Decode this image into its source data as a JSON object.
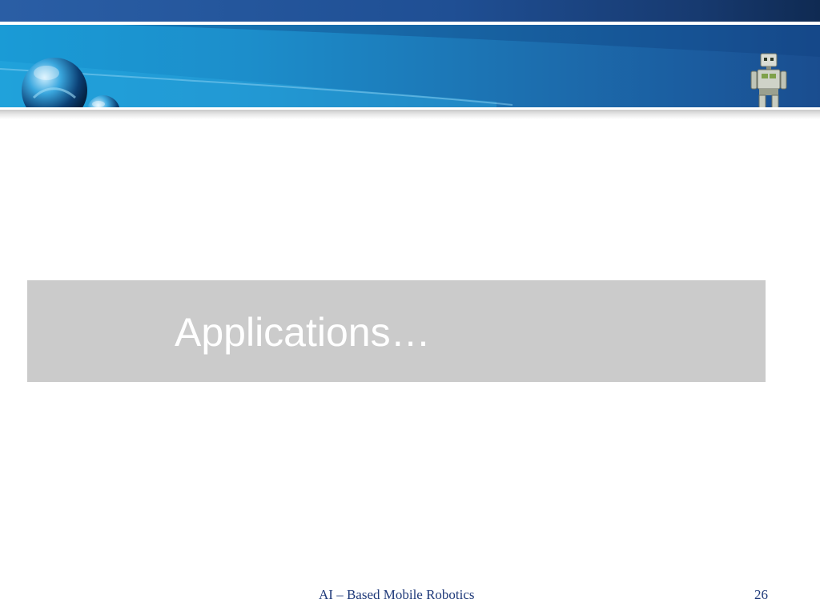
{
  "slide": {
    "title": "Applications…",
    "footer": "AI – Based Mobile Robotics",
    "page_number": "26"
  },
  "icons": {
    "logo": "blue-spheres-logo-icon",
    "mascot": "robot-icon"
  },
  "colors": {
    "banner_light": "#1a9bd6",
    "banner_dark": "#1a4d8f",
    "title_band": "#cbcbcb",
    "title_text": "#ffffff",
    "footer_text": "#1f3a7a"
  }
}
